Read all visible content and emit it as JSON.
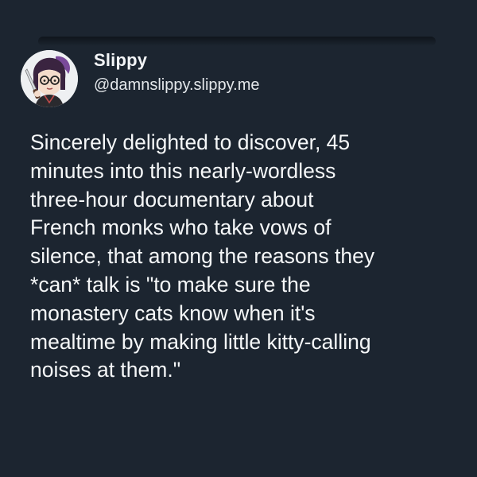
{
  "post": {
    "author": {
      "display_name": "Slippy",
      "handle": "@damnslippy.slippy.me",
      "avatar_icon": "cartoon-avatar-with-knife"
    },
    "text_lines": [
      "Sincerely delighted to discover, 45",
      "minutes into this nearly-wordless",
      "three-hour documentary about",
      "French monks who take vows of",
      "silence, that among the reasons they",
      "*can* talk is \"to make sure the",
      "monastery cats know when it's",
      "mealtime by making little kitty-calling",
      "noises at them.\""
    ]
  },
  "colors": {
    "background": "#1c2530",
    "text": "#f5f7f8",
    "avatar_bg": "#eef0f2",
    "avatar_hair": "#3a2440",
    "avatar_hat": "#7a4a9a"
  }
}
